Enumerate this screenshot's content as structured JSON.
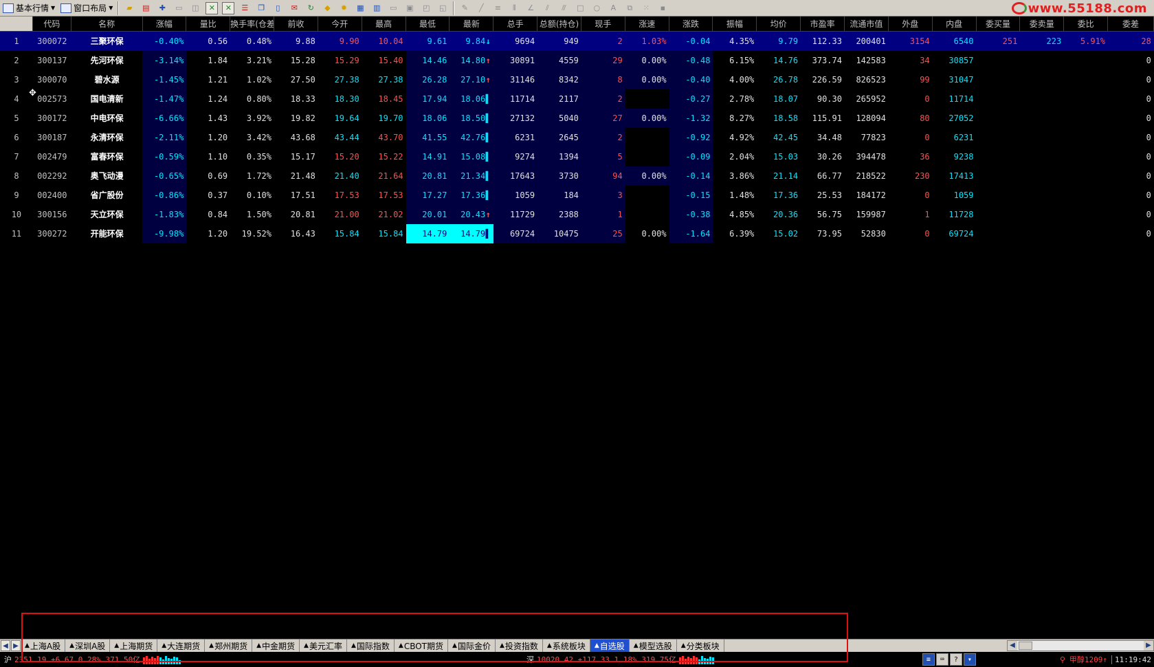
{
  "toolbar": {
    "basic_quotes": "基本行情",
    "window_layout": "窗口布局",
    "icons": [
      "open-folder-icon",
      "color-bar-icon",
      "crosshair-icon",
      "panel-icon",
      "zoom-icon",
      "excel-icon",
      "excel-icon-2",
      "list-icon",
      "copy-icon",
      "doc-icon",
      "mail-icon",
      "refresh-icon",
      "warning-icon",
      "gear-icon",
      "chart-icon",
      "grid-icon",
      "window-icon",
      "window2-icon",
      "tile-icon",
      "layout-icon",
      "pen-icon",
      "line-icon",
      "hlines-icon",
      "vlines-icon",
      "angle-icon",
      "fan-icon",
      "parallel-icon",
      "rect-icon",
      "circle-icon",
      "text-icon",
      "shapes-icon",
      "dots-icon",
      "save-icon"
    ],
    "logo_text": "www.55188.com"
  },
  "columns": [
    "",
    "代码",
    "名称",
    "涨幅",
    "量比",
    "换手率(仓差",
    "前收",
    "今开",
    "最高",
    "最低",
    "最新",
    "总手",
    "总额(持仓)",
    "现手",
    "涨速",
    "涨跌",
    "振幅",
    "均价",
    "市盈率",
    "流通市值",
    "外盘",
    "内盘",
    "委买量",
    "委卖量",
    "委比",
    "委差"
  ],
  "rows": [
    {
      "n": "1",
      "code": "300072",
      "name": "三聚环保",
      "chg": "-0.40%",
      "vr": "0.56",
      "turn": "0.48%",
      "prev": "9.88",
      "open": "9.90",
      "high": "10.04",
      "low": "9.61",
      "last": "9.84",
      "arrow": "down",
      "vol": "9694",
      "amt": "949",
      "cur": "2",
      "speed": "1.03%",
      "diff": "-0.04",
      "amp": "4.35%",
      "avg": "9.79",
      "pe": "112.33",
      "mcap": "200401",
      "outer": "3154",
      "inner": "6540",
      "bid": "251",
      "ask": "223",
      "ratio": "5.91%",
      "delta": "28"
    },
    {
      "n": "2",
      "code": "300137",
      "name": "先河环保",
      "chg": "-3.14%",
      "vr": "1.84",
      "turn": "3.21%",
      "prev": "15.28",
      "open": "15.29",
      "high": "15.40",
      "low": "14.46",
      "last": "14.80",
      "arrow": "up",
      "vol": "30891",
      "amt": "4559",
      "cur": "29",
      "speed": "0.00%",
      "diff": "-0.48",
      "amp": "6.15%",
      "avg": "14.76",
      "pe": "373.74",
      "mcap": "142583",
      "outer": "34",
      "inner": "30857",
      "bid": "",
      "ask": "",
      "ratio": "",
      "delta": "0"
    },
    {
      "n": "3",
      "code": "300070",
      "name": "碧水源",
      "chg": "-1.45%",
      "vr": "1.21",
      "turn": "1.02%",
      "prev": "27.50",
      "open": "27.38",
      "high": "27.38",
      "low": "26.28",
      "last": "27.10",
      "arrow": "up",
      "vol": "31146",
      "amt": "8342",
      "cur": "8",
      "speed": "0.00%",
      "diff": "-0.40",
      "amp": "4.00%",
      "avg": "26.78",
      "pe": "226.59",
      "mcap": "826523",
      "outer": "99",
      "inner": "31047",
      "bid": "",
      "ask": "",
      "ratio": "",
      "delta": "0"
    },
    {
      "n": "4",
      "code": "002573",
      "name": "国电清新",
      "chg": "-1.47%",
      "vr": "1.24",
      "turn": "0.80%",
      "prev": "18.33",
      "open": "18.30",
      "high": "18.45",
      "low": "17.94",
      "last": "18.06",
      "arrow": "bar",
      "vol": "11714",
      "amt": "2117",
      "cur": "2",
      "speed": "",
      "diff": "-0.27",
      "amp": "2.78%",
      "avg": "18.07",
      "pe": "90.30",
      "mcap": "265952",
      "outer": "0",
      "inner": "11714",
      "bid": "",
      "ask": "",
      "ratio": "",
      "delta": "0"
    },
    {
      "n": "5",
      "code": "300172",
      "name": "中电环保",
      "chg": "-6.66%",
      "vr": "1.43",
      "turn": "3.92%",
      "prev": "19.82",
      "open": "19.64",
      "high": "19.70",
      "low": "18.06",
      "last": "18.50",
      "arrow": "bar",
      "vol": "27132",
      "amt": "5040",
      "cur": "27",
      "speed": "0.00%",
      "diff": "-1.32",
      "amp": "8.27%",
      "avg": "18.58",
      "pe": "115.91",
      "mcap": "128094",
      "outer": "80",
      "inner": "27052",
      "bid": "",
      "ask": "",
      "ratio": "",
      "delta": "0"
    },
    {
      "n": "6",
      "code": "300187",
      "name": "永清环保",
      "chg": "-2.11%",
      "vr": "1.20",
      "turn": "3.42%",
      "prev": "43.68",
      "open": "43.44",
      "high": "43.70",
      "low": "41.55",
      "last": "42.76",
      "arrow": "bar",
      "vol": "6231",
      "amt": "2645",
      "cur": "2",
      "speed": "",
      "diff": "-0.92",
      "amp": "4.92%",
      "avg": "42.45",
      "pe": "34.48",
      "mcap": "77823",
      "outer": "0",
      "inner": "6231",
      "bid": "",
      "ask": "",
      "ratio": "",
      "delta": "0"
    },
    {
      "n": "7",
      "code": "002479",
      "name": "富春环保",
      "chg": "-0.59%",
      "vr": "1.10",
      "turn": "0.35%",
      "prev": "15.17",
      "open": "15.20",
      "high": "15.22",
      "low": "14.91",
      "last": "15.08",
      "arrow": "bar",
      "vol": "9274",
      "amt": "1394",
      "cur": "5",
      "speed": "",
      "diff": "-0.09",
      "amp": "2.04%",
      "avg": "15.03",
      "pe": "30.26",
      "mcap": "394478",
      "outer": "36",
      "inner": "9238",
      "bid": "",
      "ask": "",
      "ratio": "",
      "delta": "0"
    },
    {
      "n": "8",
      "code": "002292",
      "name": "奥飞动漫",
      "chg": "-0.65%",
      "vr": "0.69",
      "turn": "1.72%",
      "prev": "21.48",
      "open": "21.40",
      "high": "21.64",
      "low": "20.81",
      "last": "21.34",
      "arrow": "bar",
      "vol": "17643",
      "amt": "3730",
      "cur": "94",
      "speed": "0.00%",
      "diff": "-0.14",
      "amp": "3.86%",
      "avg": "21.14",
      "pe": "66.77",
      "mcap": "218522",
      "outer": "230",
      "inner": "17413",
      "bid": "",
      "ask": "",
      "ratio": "",
      "delta": "0"
    },
    {
      "n": "9",
      "code": "002400",
      "name": "省广股份",
      "chg": "-0.86%",
      "vr": "0.37",
      "turn": "0.10%",
      "prev": "17.51",
      "open": "17.53",
      "high": "17.53",
      "low": "17.27",
      "last": "17.36",
      "arrow": "bar",
      "vol": "1059",
      "amt": "184",
      "cur": "3",
      "speed": "",
      "diff": "-0.15",
      "amp": "1.48%",
      "avg": "17.36",
      "pe": "25.53",
      "mcap": "184172",
      "outer": "0",
      "inner": "1059",
      "bid": "",
      "ask": "",
      "ratio": "",
      "delta": "0"
    },
    {
      "n": "10",
      "code": "300156",
      "name": "天立环保",
      "chg": "-1.83%",
      "vr": "0.84",
      "turn": "1.50%",
      "prev": "20.81",
      "open": "21.00",
      "high": "21.02",
      "low": "20.01",
      "last": "20.43",
      "arrow": "up",
      "vol": "11729",
      "amt": "2388",
      "cur": "1",
      "speed": "",
      "diff": "-0.38",
      "amp": "4.85%",
      "avg": "20.36",
      "pe": "56.75",
      "mcap": "159987",
      "outer": "1",
      "inner": "11728",
      "bid": "",
      "ask": "",
      "ratio": "",
      "delta": "0"
    },
    {
      "n": "11",
      "code": "300272",
      "name": "开能环保",
      "chg": "-9.98%",
      "vr": "1.20",
      "turn": "19.52%",
      "prev": "16.43",
      "open": "15.84",
      "high": "15.84",
      "low": "14.79",
      "last": "14.79",
      "arrow": "bar",
      "vol": "69724",
      "amt": "10475",
      "cur": "25",
      "speed": "0.00%",
      "diff": "-1.64",
      "amp": "6.39%",
      "avg": "15.02",
      "pe": "73.95",
      "mcap": "52830",
      "outer": "0",
      "inner": "69724",
      "bid": "",
      "ask": "",
      "ratio": "",
      "delta": "0"
    }
  ],
  "tabs": [
    "上海A股",
    "深圳A股",
    "上海期货",
    "大连期货",
    "郑州期货",
    "中金期货",
    "美元汇率",
    "国际指数",
    "CBOT期货",
    "国际金价",
    "投资指数",
    "系统板块",
    "自选股",
    "模型选股",
    "分类板块"
  ],
  "active_tab": "自选股",
  "status": {
    "sh_label": "沪",
    "sh_text": "2351.19 +6.67 0.28% 371.50亿",
    "sz_label": "深",
    "sz_text": "10020.42 +117.33 1.18% 319.75亿",
    "alert": "甲醇1209↑",
    "time": "11:19:42"
  },
  "colors": {
    "up": "#ff5050",
    "down": "#00e5ff",
    "selected_row": "#000080",
    "annotation": "#e01010"
  }
}
